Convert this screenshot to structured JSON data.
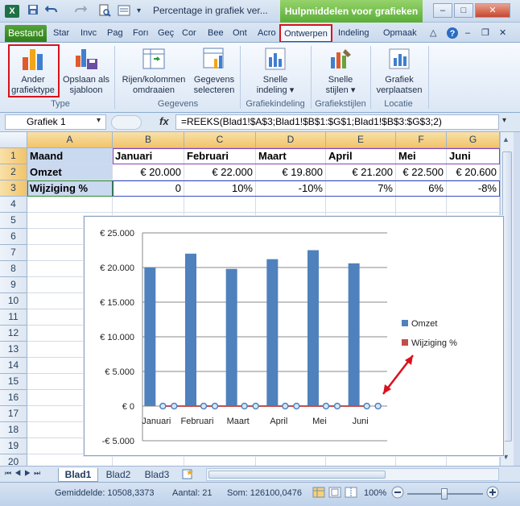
{
  "window": {
    "title": "Percentage in grafiek ver...",
    "contextual_group": "Hulpmiddelen voor grafieken",
    "app_icon": "X",
    "controls": [
      "–",
      "□",
      "✕"
    ]
  },
  "tabs": [
    {
      "label": "Bestand"
    },
    {
      "label": "Star"
    },
    {
      "label": "Invc"
    },
    {
      "label": "Pag"
    },
    {
      "label": "Forı"
    },
    {
      "label": "Geç"
    },
    {
      "label": "Cor"
    },
    {
      "label": "Bee"
    },
    {
      "label": "Ont"
    },
    {
      "label": "Acro"
    },
    {
      "label": "Ontwerpen"
    },
    {
      "label": "Indeling"
    },
    {
      "label": "Opmaak"
    }
  ],
  "ribbon": {
    "groups": [
      {
        "label": "Type",
        "buttons": [
          {
            "label1": "Ander",
            "label2": "grafiektype"
          },
          {
            "label1": "Opslaan als",
            "label2": "sjabloon"
          }
        ]
      },
      {
        "label": "Gegevens",
        "buttons": [
          {
            "label1": "Rijen/kolommen",
            "label2": "omdraaien"
          },
          {
            "label1": "Gegevens",
            "label2": "selecteren"
          }
        ]
      },
      {
        "label": "Grafiekindeling",
        "buttons": [
          {
            "label1": "Snelle",
            "label2": "indeling ▾"
          }
        ]
      },
      {
        "label": "Grafiekstijlen",
        "buttons": [
          {
            "label1": "Snelle",
            "label2": "stijlen ▾"
          }
        ]
      },
      {
        "label": "Locatie",
        "buttons": [
          {
            "label1": "Grafiek",
            "label2": "verplaatsen"
          }
        ]
      }
    ]
  },
  "formula_bar": {
    "name_box": "Grafiek 1",
    "fx": "fx",
    "formula": "=REEKS(Blad1!$A$3;Blad1!$B$1:$G$1;Blad1!$B$3:$G$3;2)"
  },
  "columns": [
    "A",
    "B",
    "C",
    "D",
    "E",
    "F",
    "G"
  ],
  "rows": [
    "1",
    "2",
    "3",
    "4",
    "5",
    "6",
    "7",
    "8",
    "9",
    "10",
    "11",
    "12",
    "13",
    "14",
    "15",
    "16",
    "17",
    "18",
    "19",
    "20"
  ],
  "table": {
    "row1": [
      "Maand",
      "Januari",
      "Februari",
      "Maart",
      "April",
      "Mei",
      "Juni"
    ],
    "row2": [
      "Omzet",
      "€ 20.000",
      "€ 22.000",
      "€ 19.800",
      "€ 21.200",
      "€ 22.500",
      "€ 20.600"
    ],
    "row3": [
      "Wijziging %",
      "0",
      "10%",
      "-10%",
      "7%",
      "6%",
      "-8%"
    ]
  },
  "chart_data": {
    "type": "bar",
    "categories": [
      "Januari",
      "Februari",
      "Maart",
      "April",
      "Mei",
      "Juni"
    ],
    "series": [
      {
        "name": "Omzet",
        "type": "bar",
        "color": "#4f81bd",
        "values": [
          20000,
          22000,
          19800,
          21200,
          22500,
          20600
        ]
      },
      {
        "name": "Wijziging %",
        "type": "line",
        "color": "#c0504d",
        "values": [
          0,
          0.1,
          -0.1,
          0.07,
          0.06,
          -0.08
        ]
      }
    ],
    "y_ticks": [
      "€ 25.000",
      "€ 20.000",
      "€ 15.000",
      "€ 10.000",
      "€ 5.000",
      "€ 0",
      "-€ 5.000"
    ],
    "ylim": [
      -5000,
      25000
    ],
    "grid": true,
    "legend_position": "right"
  },
  "sheets": [
    "Blad1",
    "Blad2",
    "Blad3"
  ],
  "status": {
    "average": "Gemiddelde: 10508,3373",
    "count": "Aantal: 21",
    "sum": "Som: 126100,0476",
    "zoom": "100%"
  },
  "colors": {
    "accent_green": "#5aad38",
    "highlight_red": "#d9111c",
    "bar_blue": "#4f81bd",
    "line_red": "#c0504d"
  }
}
